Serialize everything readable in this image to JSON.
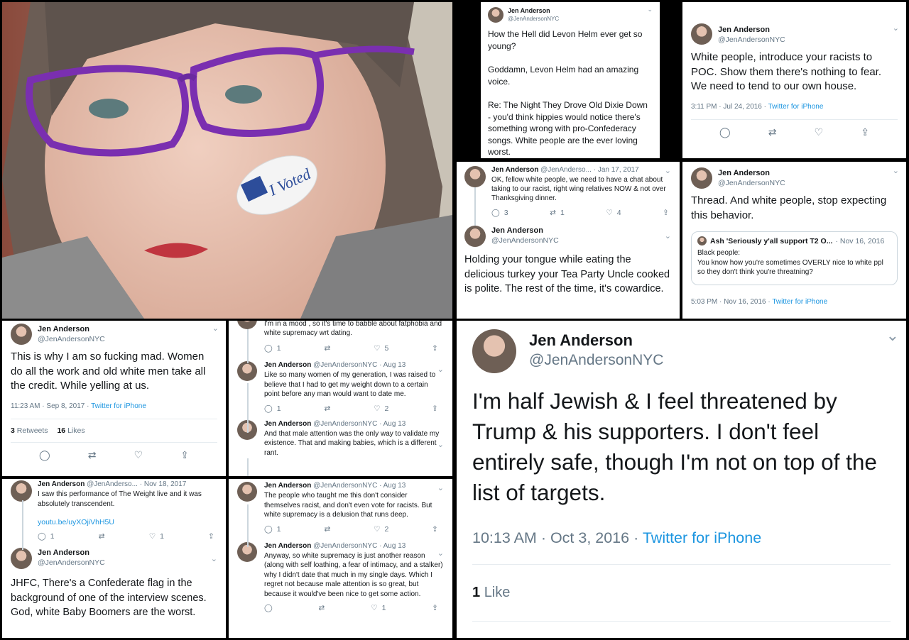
{
  "author": {
    "name": "Jen Anderson",
    "handle": "@JenAndersonNYC",
    "handle_short": "@JenAnderso..."
  },
  "photo": {
    "sticker_text": "I Voted"
  },
  "p1": {
    "lines": [
      "How the Hell did Levon Helm ever get so young?",
      "Goddamn, Levon Helm had an amazing voice.",
      "Re: The Night They Drove Old Dixie Down - you'd think hippies would notice there's something wrong with pro-Confederacy songs. White people are the ever loving worst."
    ]
  },
  "p2": {
    "text": "White people, introduce your racists to POC. Show them there's nothing to fear. We need to tend to our own house.",
    "time": "3:11 PM · Jul 24, 2016",
    "source": "Twitter for iPhone"
  },
  "p3": {
    "date": "· Jan 17, 2017",
    "text": "OK, fellow white people, we need to have a chat about taking to our racist, right wing relatives NOW & not over Thanksgiving dinner.",
    "replies": "3",
    "retweets": "1",
    "likes": "4",
    "text2": "Holding your tongue while eating the delicious turkey your Tea Party Uncle cooked is polite. The rest of the time, it's cowardice."
  },
  "p4": {
    "text": "Thread. And white people, stop expecting this behavior.",
    "quote_name": "Ash 'Seriously y'all support T2 O...",
    "quote_date": "· Nov 16, 2016",
    "quote_text": "Black people:\nYou know how you're sometimes OVERLY nice to white ppl so they don't think you're threatning?",
    "time": "5:03 PM · Nov 16, 2016",
    "source": "Twitter for iPhone"
  },
  "p5": {
    "text": "This is why I am so fucking mad. Women do all the work and old white men take all the credit. While yelling at us.",
    "time": "11:23 AM · Sep 8, 2017",
    "source": "Twitter for iPhone",
    "retweets": "3",
    "retweets_label": "Retweets",
    "likes": "16",
    "likes_label": "Likes"
  },
  "p6": {
    "t0": {
      "text": "I'm in a mood , so it's time to babble about fatphobia and white supremacy wrt dating.",
      "replies": "1",
      "likes": "5"
    },
    "t1": {
      "date": "· Aug 13",
      "text": "Like so many women of my generation, I was raised to believe that I had to get my weight down to a certain point before any man would want to date me.",
      "replies": "1",
      "likes": "2"
    },
    "t2": {
      "date": "· Aug 13",
      "text": "And that male attention was the only way to validate my existence. That and making babies, which is a different rant."
    }
  },
  "p7": {
    "date": "· Nov 18, 2017",
    "text": "I saw this performance of The Weight live and it was absolutely transcendent.",
    "link": "youtu.be/uyXOjiVhH5U",
    "replies": "1",
    "likes": "1",
    "text2": "JHFC, There's a Confederate flag in the background of one of the interview scenes. God, white Baby Boomers are the worst."
  },
  "p8": {
    "t1": {
      "date": "· Aug 13",
      "text": "The people who taught me this don't consider themselves racist, and don't even vote for racists. But white supremacy is a delusion that runs deep.",
      "replies": "1",
      "likes": "2"
    },
    "t2": {
      "date": "· Aug 13",
      "text": "Anyway, so white supremacy is just another reason (along with self loathing, a fear of intimacy, and a stalker) why I didn't date that much in my single days. Which I regret not because male attention is so great, but because it would've been nice to get some action.",
      "likes": "1"
    }
  },
  "p9": {
    "text": "I'm half Jewish & I feel threatened by Trump & his supporters. I don't feel entirely safe, though I'm not on top of the list of targets.",
    "time": "10:13 AM · Oct 3, 2016",
    "sep": "·",
    "source": "Twitter for iPhone",
    "likes": "1",
    "likes_label": "Like"
  },
  "icons": {
    "reply": "reply-icon",
    "retweet": "retweet-icon",
    "like": "heart-icon",
    "share": "share-icon",
    "more": "chevron-down-icon"
  },
  "colors": {
    "link": "#1b95e0",
    "secondary": "#657786",
    "text": "#14171a",
    "frame": "#000000"
  }
}
